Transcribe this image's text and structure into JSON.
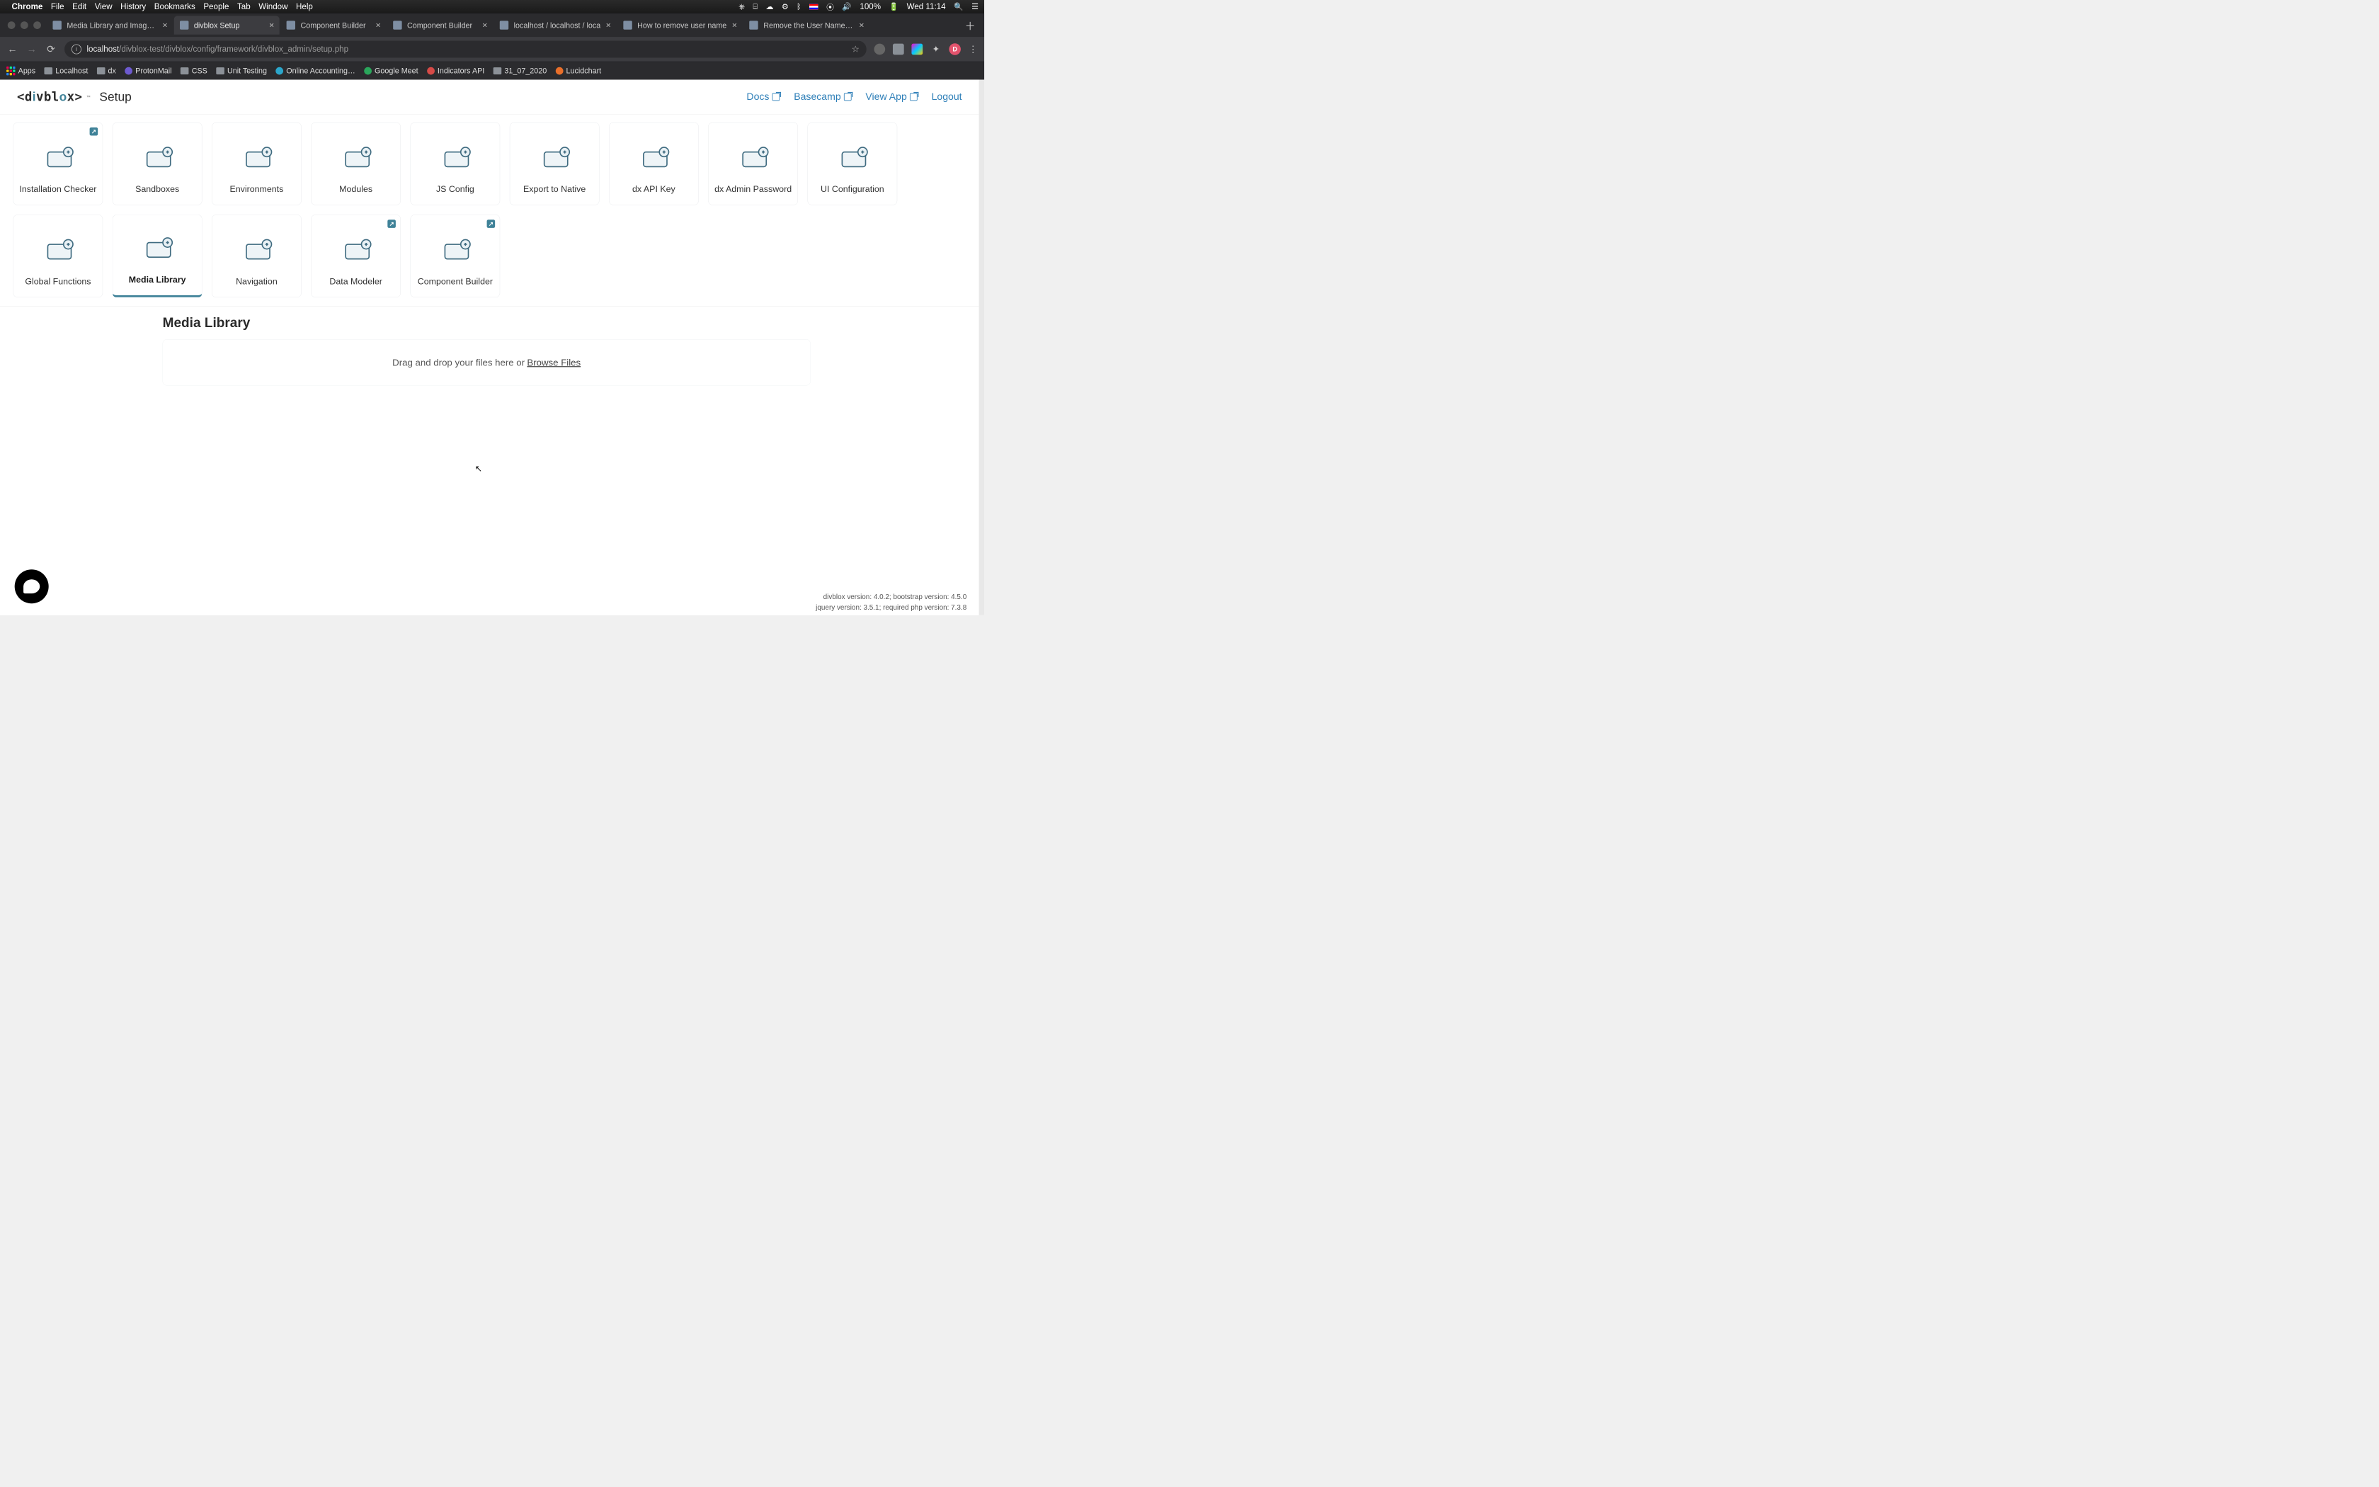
{
  "menubar": {
    "app_name": "Chrome",
    "items": [
      "File",
      "Edit",
      "View",
      "History",
      "Bookmarks",
      "People",
      "Tab",
      "Window",
      "Help"
    ],
    "battery": "100%",
    "clock": "Wed 11:14"
  },
  "tabs": [
    {
      "title": "Media Library and Image V",
      "active": false
    },
    {
      "title": "divblox Setup",
      "active": true
    },
    {
      "title": "Component Builder",
      "active": false
    },
    {
      "title": "Component Builder",
      "active": false
    },
    {
      "title": "localhost / localhost / loca",
      "active": false
    },
    {
      "title": "How to remove user name",
      "active": false
    },
    {
      "title": "Remove the User Name fro",
      "active": false
    }
  ],
  "url": {
    "host": "localhost",
    "path": "/divblox-test/divblox/config/framework/divblox_admin/setup.php"
  },
  "bookmarks": [
    "Apps",
    "Localhost",
    "dx",
    "ProtonMail",
    "CSS",
    "Unit Testing",
    "Online Accounting…",
    "Google Meet",
    "Indicators API",
    "31_07_2020",
    "Lucidchart"
  ],
  "header": {
    "brand": "divblox",
    "page": "Setup",
    "links": {
      "docs": "Docs",
      "basecamp": "Basecamp",
      "view_app": "View App",
      "logout": "Logout"
    }
  },
  "cards": [
    {
      "key": "installation-checker",
      "label": "Installation Checker",
      "corner": true
    },
    {
      "key": "sandboxes",
      "label": "Sandboxes",
      "corner": false
    },
    {
      "key": "environments",
      "label": "Environments",
      "corner": false
    },
    {
      "key": "modules",
      "label": "Modules",
      "corner": false
    },
    {
      "key": "js-config",
      "label": "JS Config",
      "corner": false
    },
    {
      "key": "export-to-native",
      "label": "Export to Native",
      "corner": false
    },
    {
      "key": "dx-api-key",
      "label": "dx API Key",
      "corner": false
    },
    {
      "key": "dx-admin-password",
      "label": "dx Admin Password",
      "corner": false
    },
    {
      "key": "ui-configuration",
      "label": "UI Configuration",
      "corner": false
    },
    {
      "key": "global-functions",
      "label": "Global Functions",
      "corner": false
    },
    {
      "key": "media-library",
      "label": "Media Library",
      "corner": false,
      "active": true
    },
    {
      "key": "navigation",
      "label": "Navigation",
      "corner": false
    },
    {
      "key": "data-modeler",
      "label": "Data Modeler",
      "corner": true
    },
    {
      "key": "component-builder",
      "label": "Component Builder",
      "corner": true
    }
  ],
  "media_library": {
    "heading": "Media Library",
    "dropzone_text": "Drag and drop your files here or",
    "browse": "Browse Files"
  },
  "footer": {
    "line1": "divblox version: 4.0.2; bootstrap version: 4.5.0",
    "line2": "jquery version: 3.5.1; required php version: 7.3.8"
  }
}
